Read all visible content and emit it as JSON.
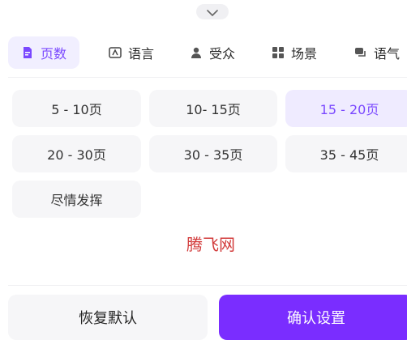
{
  "tabs": [
    {
      "label": "页数",
      "icon": "document-icon",
      "active": true
    },
    {
      "label": "语言",
      "icon": "language-icon",
      "active": false
    },
    {
      "label": "受众",
      "icon": "person-icon",
      "active": false
    },
    {
      "label": "场景",
      "icon": "grid-icon",
      "active": false
    },
    {
      "label": "语气",
      "icon": "chat-icon",
      "active": false
    }
  ],
  "options": [
    {
      "label": "5 - 10页",
      "selected": false
    },
    {
      "label": "10- 15页",
      "selected": false
    },
    {
      "label": "15 - 20页",
      "selected": true
    },
    {
      "label": "20 - 30页",
      "selected": false
    },
    {
      "label": "30 - 35页",
      "selected": false
    },
    {
      "label": "35 - 45页",
      "selected": false
    },
    {
      "label": "尽情发挥",
      "selected": false
    }
  ],
  "watermark": "腾飞网",
  "buttons": {
    "reset": "恢复默认",
    "confirm": "确认设置"
  },
  "colors": {
    "accent": "#7a48ff",
    "confirm_bg": "#7a2dff",
    "selected_bg": "#efebff",
    "option_bg": "#f6f6f8",
    "watermark": "#d23a3a"
  }
}
